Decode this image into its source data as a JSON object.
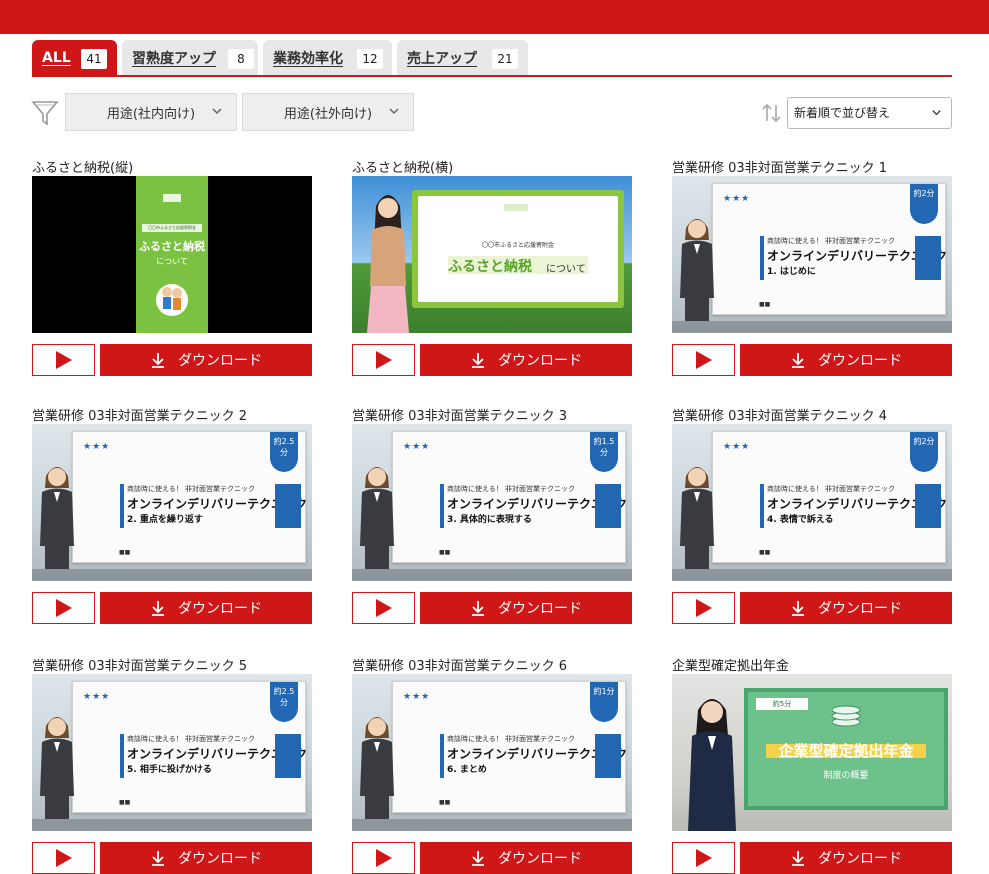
{
  "colors": {
    "brand_red": "#cf1718",
    "slide_blue": "#2167b1"
  },
  "tabs": [
    {
      "label": "ALL",
      "count": "41"
    },
    {
      "label": "習熟度アップ",
      "count": "8"
    },
    {
      "label": "業務効率化",
      "count": "12"
    },
    {
      "label": "売上アップ",
      "count": "21"
    }
  ],
  "filters": {
    "icon": "filter-icon",
    "internal": "用途(社内向け)",
    "external": "用途(社外向け)"
  },
  "sort": {
    "icon": "sort-icon",
    "selected": "新着順で並び替え"
  },
  "buttons": {
    "download": "ダウンロード"
  },
  "videos": [
    {
      "title": "ふるさと納税(縦)",
      "thumb": {
        "small_label": "〇〇市ふるさと応援寄附金",
        "headline": "ふるさと納税",
        "sub": "について"
      }
    },
    {
      "title": "ふるさと納税(横)",
      "thumb": {
        "small_label": "〇〇市ふるさと応援寄附金",
        "headline": "ふるさと納税",
        "sub": "について"
      }
    },
    {
      "title": "営業研修 03非対面営業テクニック 1",
      "thumb": {
        "sub": "商談時に使える！ 非対面営業テクニック",
        "main": "オンラインデリバリーテクニック",
        "part": "1. はじめに",
        "badge": "約2分"
      }
    },
    {
      "title": "営業研修 03非対面営業テクニック 2",
      "thumb": {
        "sub": "商談時に使える！ 非対面営業テクニック",
        "main": "オンラインデリバリーテクニック",
        "part": "2. 重点を繰り返す",
        "badge": "約2.5分"
      }
    },
    {
      "title": "営業研修 03非対面営業テクニック 3",
      "thumb": {
        "sub": "商談時に使える！ 非対面営業テクニック",
        "main": "オンラインデリバリーテクニック",
        "part": "3. 具体的に表現する",
        "badge": "約1.5分"
      }
    },
    {
      "title": "営業研修 03非対面営業テクニック 4",
      "thumb": {
        "sub": "商談時に使える！ 非対面営業テクニック",
        "main": "オンラインデリバリーテクニック",
        "part": "4. 表情で訴える",
        "badge": "約2分"
      }
    },
    {
      "title": "営業研修 03非対面営業テクニック 5",
      "thumb": {
        "sub": "商談時に使える！ 非対面営業テクニック",
        "main": "オンラインデリバリーテクニック",
        "part": "5. 相手に投げかける",
        "badge": "約2.5分"
      }
    },
    {
      "title": "営業研修 03非対面営業テクニック 6",
      "thumb": {
        "sub": "商談時に使える！ 非対面営業テクニック",
        "main": "オンラインデリバリーテクニック",
        "part": "6. まとめ",
        "badge": "約1分"
      }
    },
    {
      "title": "企業型確定拠出年金",
      "thumb": {
        "badge": "約5分",
        "headline": "企業型確定拠出年金",
        "sub": "制度の概要"
      }
    }
  ]
}
